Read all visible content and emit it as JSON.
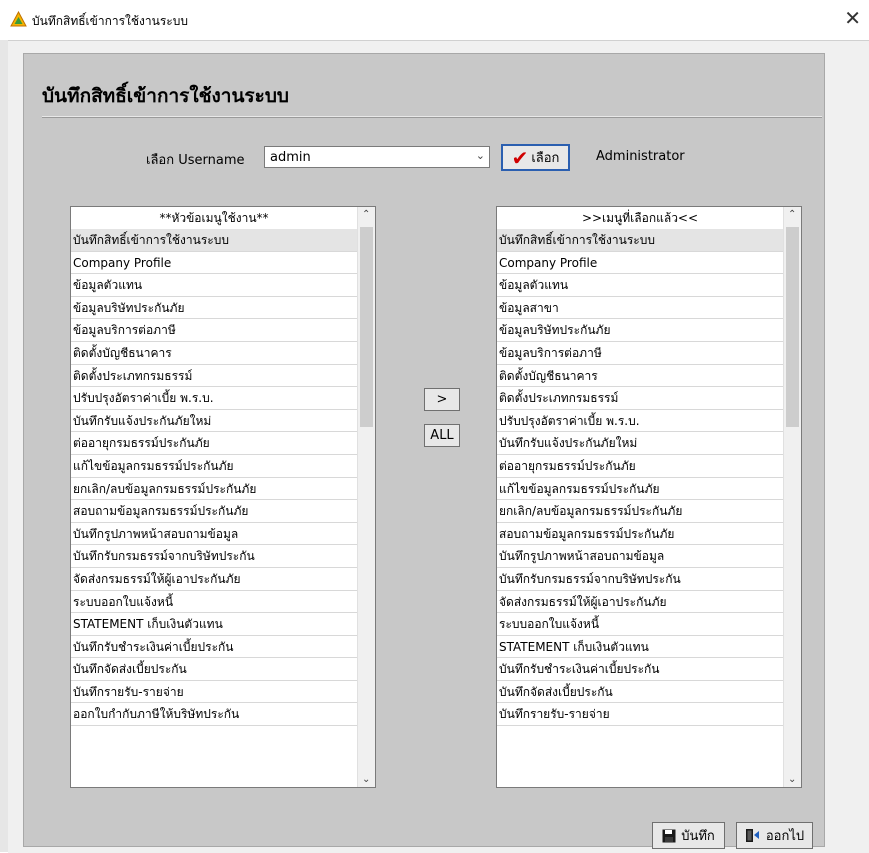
{
  "window": {
    "title": "บันทึกสิทธิ์เข้าการใช้งานระบบ",
    "close_glyph": "✕"
  },
  "form": {
    "heading": "บันทึกสิทธิ์เข้าการใช้งานระบบ",
    "username_label": "เลือก Username",
    "username_value": "admin",
    "select_button": "เลือก",
    "user_fullname": "Administrator"
  },
  "available_list": {
    "header": "**หัวข้อเมนูใช้งาน**",
    "items": [
      "บันทึกสิทธิ์เข้าการใช้งานระบบ",
      "Company Profile",
      "ข้อมูลตัวแทน",
      "ข้อมูลบริษัทประกันภัย",
      "ข้อมูลบริการต่อภาษี",
      "ติดตั้งบัญชีธนาคาร",
      "ติดตั้งประเภทกรมธรรม์",
      "ปรับปรุงอัตราค่าเบี้ย พ.ร.บ.",
      "บันทึกรับแจ้งประกันภัยใหม่",
      "ต่ออายุกรมธรรม์ประกันภัย",
      "แก้ไขข้อมูลกรมธรรม์ประกันภัย",
      "ยกเลิก/ลบข้อมูลกรมธรรม์ประกันภัย",
      "สอบถามข้อมูลกรมธรรม์ประกันภัย",
      "บันทึกรูปภาพหน้าสอบถามข้อมูล",
      "บันทึกรับกรมธรรม์จากบริษัทประกัน",
      "จัดส่งกรมธรรม์ให้ผู้เอาประกันภัย",
      "ระบบออกใบแจ้งหนี้",
      "STATEMENT เก็บเงินตัวแทน",
      "บันทึกรับชำระเงินค่าเบี้ยประกัน",
      "บันทึกจัดส่งเบี้ยประกัน",
      "บันทึกรายรับ-รายจ่าย",
      "ออกใบกำกับภาษีให้บริษัทประกัน"
    ]
  },
  "selected_list": {
    "header": ">>เมนูที่เลือกแล้ว<<",
    "items": [
      "บันทึกสิทธิ์เข้าการใช้งานระบบ",
      "Company Profile",
      "ข้อมูลตัวแทน",
      "ข้อมูลสาขา",
      "ข้อมูลบริษัทประกันภัย",
      "ข้อมูลบริการต่อภาษี",
      "ติดตั้งบัญชีธนาคาร",
      "ติดตั้งประเภทกรมธรรม์",
      "ปรับปรุงอัตราค่าเบี้ย พ.ร.บ.",
      "บันทึกรับแจ้งประกันภัยใหม่",
      "ต่ออายุกรมธรรม์ประกันภัย",
      "แก้ไขข้อมูลกรมธรรม์ประกันภัย",
      "ยกเลิก/ลบข้อมูลกรมธรรม์ประกันภัย",
      "สอบถามข้อมูลกรมธรรม์ประกันภัย",
      "บันทึกรูปภาพหน้าสอบถามข้อมูล",
      "บันทึกรับกรมธรรม์จากบริษัทประกัน",
      "จัดส่งกรมธรรม์ให้ผู้เอาประกันภัย",
      "ระบบออกใบแจ้งหนี้",
      "STATEMENT เก็บเงินตัวแทน",
      "บันทึกรับชำระเงินค่าเบี้ยประกัน",
      "บันทึกจัดส่งเบี้ยประกัน",
      "บันทึกรายรับ-รายจ่าย"
    ]
  },
  "transfer": {
    "move_one": ">",
    "move_all": "ALL"
  },
  "actions": {
    "save": "บันทึก",
    "exit": "ออกไป"
  },
  "icons": {
    "app": "app-logo-icon",
    "check": "check-icon",
    "save": "floppy-disk-icon",
    "exit": "exit-door-icon"
  },
  "colors": {
    "panel": "#c8c8c8",
    "window_bg": "#f0f0f0",
    "check": "#d00000",
    "focus_border": "#2b5fb0"
  }
}
